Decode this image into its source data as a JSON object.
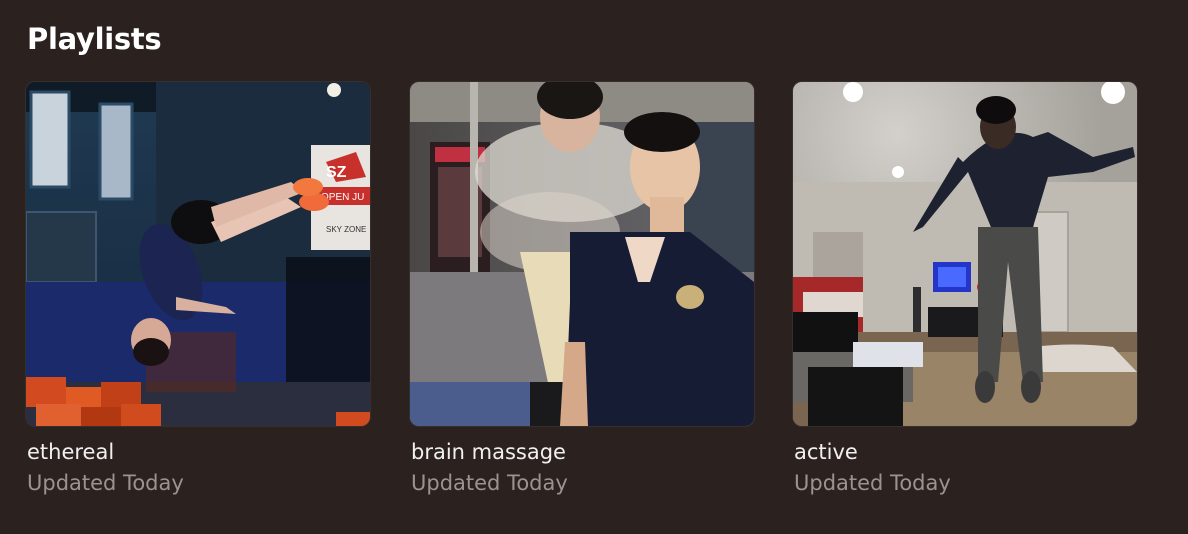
{
  "section": {
    "title": "Playlists"
  },
  "playlists": [
    {
      "title": "ethereal",
      "subtitle": "Updated Today",
      "artwork": "trampoline-flip-photo"
    },
    {
      "title": "brain massage",
      "subtitle": "Updated Today",
      "artwork": "two-people-jump-photo"
    },
    {
      "title": "active",
      "subtitle": "Updated Today",
      "artwork": "basement-jump-photo"
    }
  ],
  "artwork_text": {
    "sign_line_1": "SZ",
    "sign_line_2": "OPEN JU",
    "sign_line_3": "SKY ZONE"
  }
}
